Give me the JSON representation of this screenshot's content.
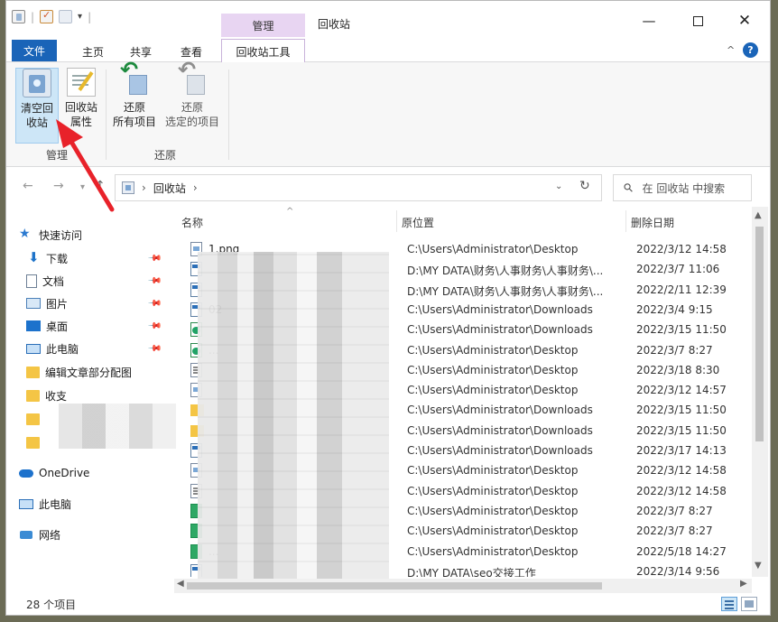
{
  "window": {
    "context_group_label": "管理",
    "title": "回收站"
  },
  "tabs": {
    "file": "文件",
    "home": "主页",
    "share": "共享",
    "view": "查看",
    "recycle_tools": "回收站工具"
  },
  "ribbon": {
    "empty_bin": "清空回\n收站",
    "empty_bin_l1": "清空回",
    "empty_bin_l2": "收站",
    "props_l1": "回收站",
    "props_l2": "属性",
    "restore_all_l1": "还原",
    "restore_all_l2": "所有项目",
    "restore_sel_l1": "还原",
    "restore_sel_l2": "选定的项目",
    "group_manage": "管理",
    "group_restore": "还原"
  },
  "address": {
    "path": "回收站",
    "search_placeholder": "在 回收站 中搜索"
  },
  "nav": {
    "quick_access": "快速访问",
    "items": [
      {
        "label": "下载",
        "icon": "download-icon"
      },
      {
        "label": "文档",
        "icon": "document-icon"
      },
      {
        "label": "图片",
        "icon": "picture-icon"
      },
      {
        "label": "桌面",
        "icon": "desktop-icon"
      },
      {
        "label": "此电脑",
        "icon": "computer-icon"
      },
      {
        "label": "编辑文章部分配图",
        "icon": "folder-icon"
      },
      {
        "label": "收支",
        "icon": "folder-icon"
      },
      {
        "label": "",
        "icon": "folder-icon"
      },
      {
        "label": "",
        "icon": "folder-icon"
      }
    ],
    "onedrive": "OneDrive",
    "this_pc": "此电脑",
    "network": "网络"
  },
  "columns": {
    "name": "名称",
    "original_location": "原位置",
    "date_deleted": "删除日期"
  },
  "files": [
    {
      "name": "1.png",
      "icon": "image",
      "orig": "C:\\Users\\Administrator\\Desktop",
      "date": "2022/3/12 14:58"
    },
    {
      "name": "",
      "icon": "win",
      "orig": "D:\\MY DATA\\财务\\人事财务\\人事财务\\...",
      "date": "2022/3/7 11:06"
    },
    {
      "name": "",
      "icon": "win",
      "orig": "D:\\MY DATA\\财务\\人事财务\\人事财务\\...",
      "date": "2022/2/11 12:39"
    },
    {
      "name": "02",
      "icon": "win",
      "orig": "C:\\Users\\Administrator\\Downloads",
      "date": "2022/3/4 9:15"
    },
    {
      "name": "",
      "icon": "xls",
      "orig": "C:\\Users\\Administrator\\Downloads",
      "date": "2022/3/15 11:50"
    },
    {
      "name": "...",
      "icon": "xls",
      "orig": "C:\\Users\\Administrator\\Desktop",
      "date": "2022/3/7 8:27"
    },
    {
      "name": "",
      "icon": "doc",
      "orig": "C:\\Users\\Administrator\\Desktop",
      "date": "2022/3/18 8:30"
    },
    {
      "name": "",
      "icon": "image",
      "orig": "C:\\Users\\Administrator\\Desktop",
      "date": "2022/3/12 14:57"
    },
    {
      "name": "",
      "icon": "folder",
      "orig": "C:\\Users\\Administrator\\Downloads",
      "date": "2022/3/15 11:50"
    },
    {
      "name": "",
      "icon": "folder",
      "orig": "C:\\Users\\Administrator\\Downloads",
      "date": "2022/3/15 11:50"
    },
    {
      "name": "",
      "icon": "win",
      "orig": "C:\\Users\\Administrator\\Downloads",
      "date": "2022/3/17 14:13"
    },
    {
      "name": "",
      "icon": "image",
      "orig": "C:\\Users\\Administrator\\Desktop",
      "date": "2022/3/12 14:58"
    },
    {
      "name": "",
      "icon": "doc",
      "orig": "C:\\Users\\Administrator\\Desktop",
      "date": "2022/3/12 14:58"
    },
    {
      "name": "",
      "icon": "pdf",
      "orig": "C:\\Users\\Administrator\\Desktop",
      "date": "2022/3/7 8:27"
    },
    {
      "name": "",
      "icon": "pdf",
      "orig": "C:\\Users\\Administrator\\Desktop",
      "date": "2022/3/7 8:27"
    },
    {
      "name": "...",
      "icon": "pdf",
      "orig": "C:\\Users\\Administrator\\Desktop",
      "date": "2022/5/18 14:27"
    },
    {
      "name": "",
      "icon": "win",
      "orig": "D:\\MY DATA\\seo交接工作",
      "date": "2022/3/14 9:56"
    }
  ],
  "status": {
    "count": "28 个项目"
  },
  "colors": {
    "accent": "#1a64b8",
    "context_tab": "#e8d5f2",
    "selected_button": "#cde6f7",
    "annotation_arrow": "#e8222a"
  }
}
